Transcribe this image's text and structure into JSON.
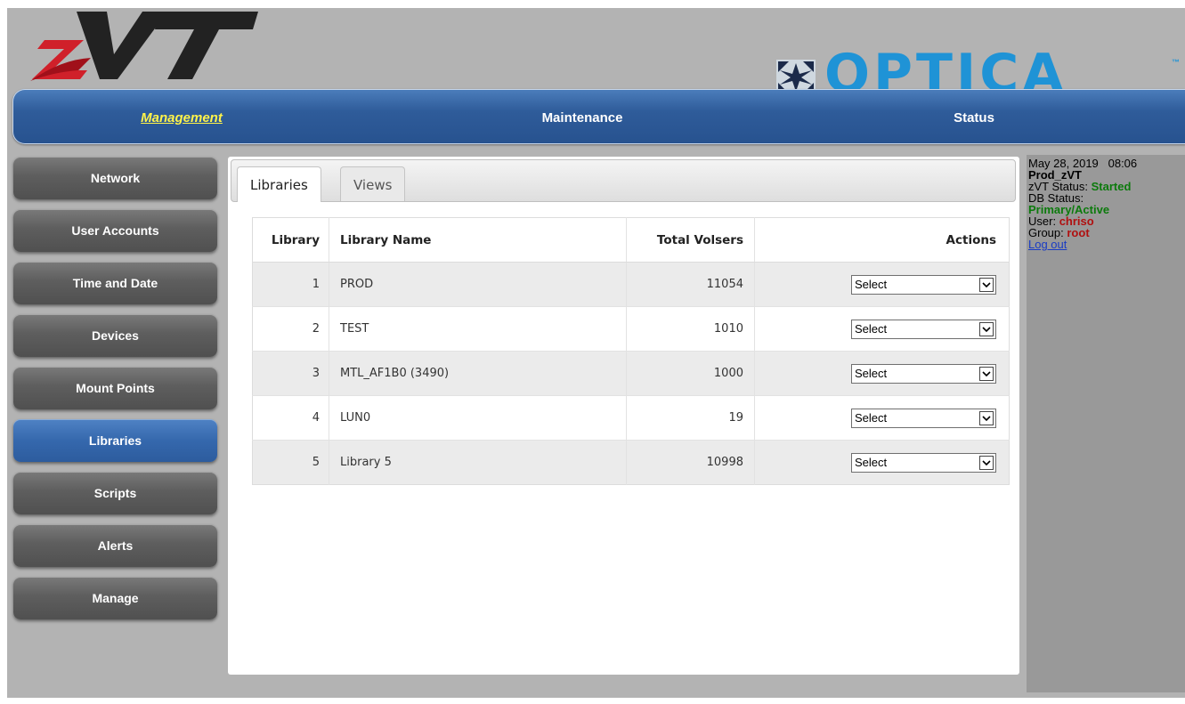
{
  "header": {
    "logo_text": "zVT",
    "brand_text": "OPTICA",
    "brand_tm": "™"
  },
  "topnav": {
    "items": [
      {
        "label": "Management",
        "active": true
      },
      {
        "label": "Maintenance",
        "active": false
      },
      {
        "label": "Status",
        "active": false
      }
    ]
  },
  "sidebar": {
    "items": [
      {
        "label": "Network"
      },
      {
        "label": "User Accounts"
      },
      {
        "label": "Time and Date"
      },
      {
        "label": "Devices"
      },
      {
        "label": "Mount Points"
      },
      {
        "label": "Libraries",
        "active": true
      },
      {
        "label": "Scripts"
      },
      {
        "label": "Alerts"
      },
      {
        "label": "Manage"
      }
    ]
  },
  "tabs": [
    {
      "label": "Libraries",
      "active": true
    },
    {
      "label": "Views",
      "active": false
    }
  ],
  "table": {
    "headers": [
      "Library",
      "Library Name",
      "Total Volsers",
      "Actions"
    ],
    "rows": [
      {
        "library": "1",
        "name": "PROD",
        "total": "11054",
        "action": "Select"
      },
      {
        "library": "2",
        "name": "TEST",
        "total": "1010",
        "action": "Select"
      },
      {
        "library": "3",
        "name": "MTL_AF1B0 (3490)",
        "total": "1000",
        "action": "Select"
      },
      {
        "library": "4",
        "name": "LUN0",
        "total": "19",
        "action": "Select"
      },
      {
        "library": "5",
        "name": "Library 5",
        "total": "10998",
        "action": "Select"
      }
    ]
  },
  "status": {
    "datetime": "May 28, 2019   08:06",
    "system_name": "Prod_zVT",
    "zvt_status_label": "zVT Status:",
    "zvt_status_value": "Started",
    "db_status_label": "DB Status:",
    "db_status_value": "Primary/Active",
    "user_label": "User:",
    "user_value": "chriso",
    "group_label": "Group:",
    "group_value": "root",
    "logout_label": "Log out"
  },
  "colors": {
    "nav_blue": "#2f5c9a",
    "nav_active_text": "#fff34a",
    "status_green": "#0c7a0c",
    "status_red": "#b01010",
    "brand_blue": "#1f93d6",
    "logo_red": "#d0202a"
  }
}
